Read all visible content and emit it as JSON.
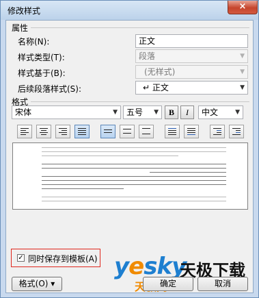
{
  "window": {
    "title": "修改样式",
    "close_glyph": "×"
  },
  "properties": {
    "group_label": "属性",
    "name_label": "名称(N):",
    "name_value": "正文",
    "type_label": "样式类型(T):",
    "type_value": "段落",
    "based_on_label": "样式基于(B):",
    "based_on_value": "(无样式)",
    "next_label": "后续段落样式(S):",
    "next_value": "↵ 正文"
  },
  "format": {
    "group_label": "格式",
    "font_value": "宋体",
    "size_value": "五号",
    "bold_label": "B",
    "italic_label": "I",
    "script_value": "中文"
  },
  "toolbar_icons": [
    "align-left-icon",
    "align-center-icon",
    "align-right-icon",
    "justify-icon",
    "single-spacing-icon",
    "one-half-spacing-icon",
    "double-spacing-icon",
    "space-before-icon",
    "space-after-icon",
    "decrease-indent-icon",
    "increase-indent-icon"
  ],
  "footer": {
    "save_to_template_label": "同时保存到模板(A)",
    "save_to_template_checked": true,
    "format_button": "格式(O) ▾",
    "ok_button": "确定",
    "cancel_button": "取消"
  },
  "watermark": {
    "brand_latin": "yesky",
    "brand_cn": "天极下载",
    "brand_cn_sub": "天极网"
  },
  "colors": {
    "highlight_border": "#e0261c",
    "selected_tool": "#b8d3f0",
    "brand_blue": "#1e7fd0",
    "brand_orange": "#f08a00"
  }
}
